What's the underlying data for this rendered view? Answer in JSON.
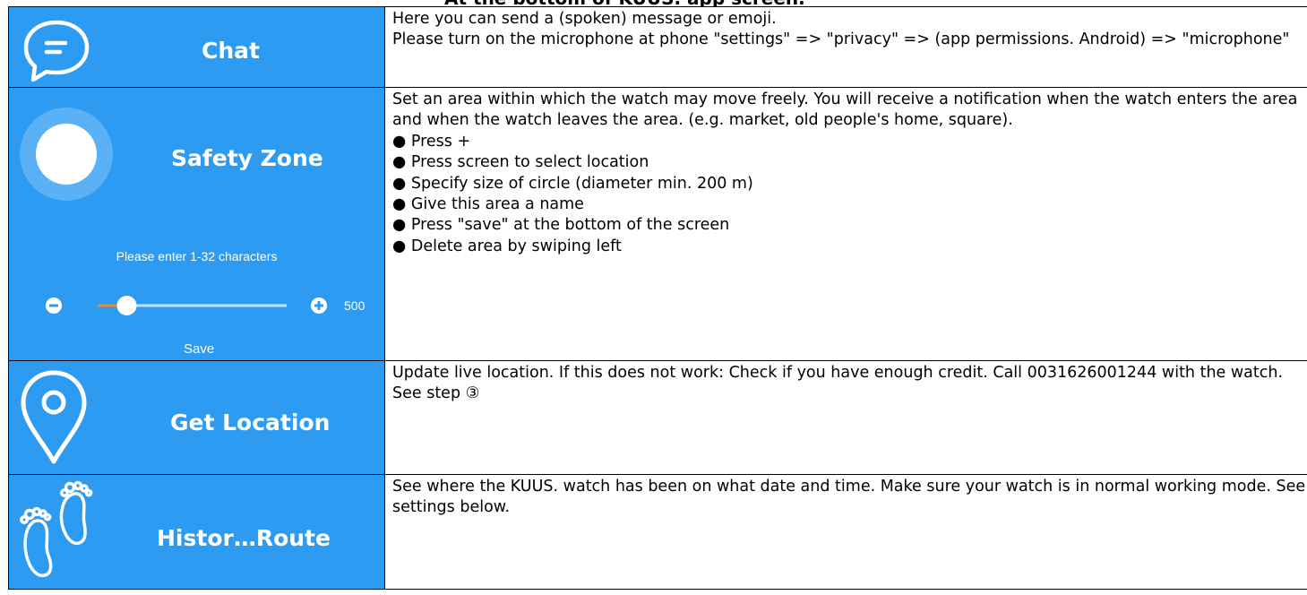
{
  "page": {
    "title": "At the bottom of KUUS. app screen."
  },
  "rows": [
    {
      "label": "Chat",
      "icon": "chat-bubble-icon",
      "description": [
        "Here you can send a (spoken) message or emoji.",
        "Please turn on the microphone at phone \"settings\" => \"privacy\" => (app permissions. Android) => \"microphone\""
      ]
    },
    {
      "label": "Safety Zone",
      "icon": "location-dot-icon",
      "hint": "Please enter 1-32 characters",
      "slider_value": "500",
      "slider_fraction": 0.15,
      "save_label": "Save",
      "description": "Set an area within which the watch may move freely. You will receive a notification when the watch enters the area and when the watch leaves the area.  (e.g. market, old people's home, square).",
      "bullets": [
        "Press +",
        "Press screen to select location",
        "Specify size of circle (diameter min. 200 m)",
        "Give this area a name",
        "Press \"save\" at the bottom of the screen",
        "Delete area by swiping left"
      ]
    },
    {
      "label": "Get Location",
      "icon": "map-pin-icon",
      "description": "Update live location. If this does not work: Check if  you have enough credit. Call 0031626001244 with the watch. See step ③"
    },
    {
      "label": "Histor…Route",
      "icon": "footprints-icon",
      "description": "See where the KUUS. watch has been on what date and time. Make sure your watch is in normal working mode. See settings below."
    }
  ],
  "colors": {
    "panel_blue": "#2e9bf2",
    "slider_accent": "#f08a24"
  }
}
